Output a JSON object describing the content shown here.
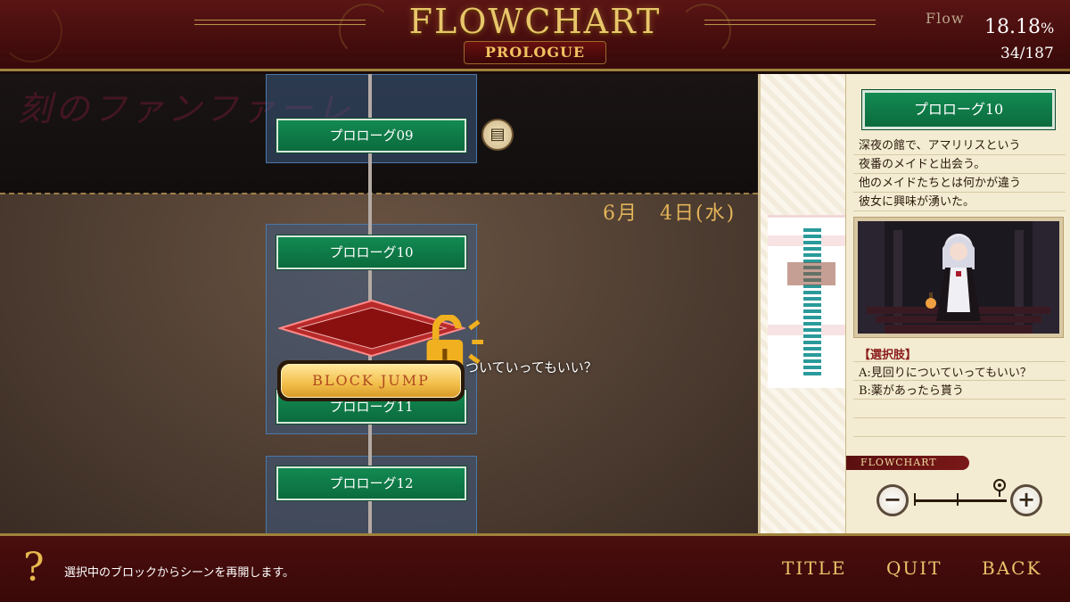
{
  "header": {
    "title": "FLOWCHART",
    "subtitle": "PROLOGUE",
    "flow_label": "Flow",
    "progress_value": "18.18",
    "progress_unit": "%",
    "progress_count": "34/187"
  },
  "flow": {
    "ghost_logo": "刻のファンファーレ",
    "date_label": "6月　4日(水)",
    "nodes": [
      {
        "label": "プロローグ09"
      },
      {
        "label": "プロローグ10"
      },
      {
        "label": "プロローグ11"
      },
      {
        "label": "プロローグ12"
      }
    ],
    "block_jump_label": "BLOCK JUMP",
    "hover_text": "ついていってもいい？",
    "doc_icon": "document-icon",
    "lock_icon": "unlock-icon"
  },
  "info": {
    "scene_title": "プロローグ10",
    "description": [
      "深夜の館で、アマリリスという",
      "夜番のメイドと出会う。",
      "他のメイドたちとは何かが違う",
      "彼女に興味が湧いた。"
    ],
    "choice_header": "【選択肢】",
    "choice_a": "A:見回りについていってもいい？",
    "choice_b": "B:薬があったら貰う",
    "flowchart_tag": "FLOWCHART",
    "zoom_minus": "−",
    "zoom_plus": "+"
  },
  "footer": {
    "help_icon": "?",
    "help_text": "選択中のブロックからシーンを再開します。",
    "title_label": "TITLE",
    "quit_label": "QUIT",
    "back_label": "BACK"
  },
  "colors": {
    "header_bg": "#4a0e0e",
    "gold": "#e8c66a",
    "node_green": "#0f7a47",
    "block_blue": "#3c5a82",
    "panel_bg": "#f3ecd2"
  }
}
